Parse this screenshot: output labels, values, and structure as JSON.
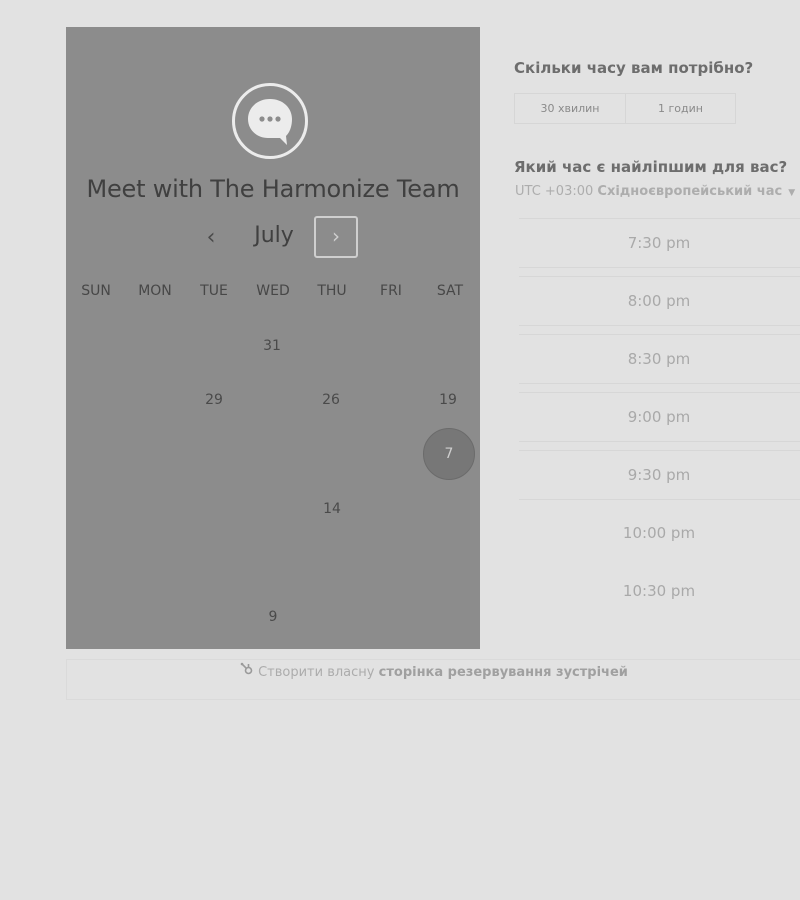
{
  "calendar": {
    "title": "Meet with The Harmonize Team",
    "month": "July",
    "prev_icon": "‹",
    "next_icon": "›",
    "weekdays": [
      "SUN",
      "MON",
      "TUE",
      "WED",
      "THU",
      "FRI",
      "SAT"
    ],
    "days": {
      "d31": "31",
      "d29": "29",
      "d26": "26",
      "d19": "19",
      "d7": "7",
      "d14": "14",
      "d9": "9"
    }
  },
  "duration": {
    "question": "Скільки часу вам потрібно?",
    "options": [
      "30 хвилин",
      "1 годин"
    ]
  },
  "time": {
    "question": "Який час є найліпшим для вас?",
    "tz_offset": "UTC +03:00",
    "tz_name": "Східноєвропейський час",
    "tz_caret": "▼",
    "slots": [
      "7:30 pm",
      "8:00 pm",
      "8:30 pm",
      "9:00 pm",
      "9:30 pm",
      "10:00 pm",
      "10:30 pm"
    ]
  },
  "footer": {
    "prefix": "Створити власну",
    "link": "сторінка резервування зустрічей",
    "icon": "sprocket-icon"
  }
}
